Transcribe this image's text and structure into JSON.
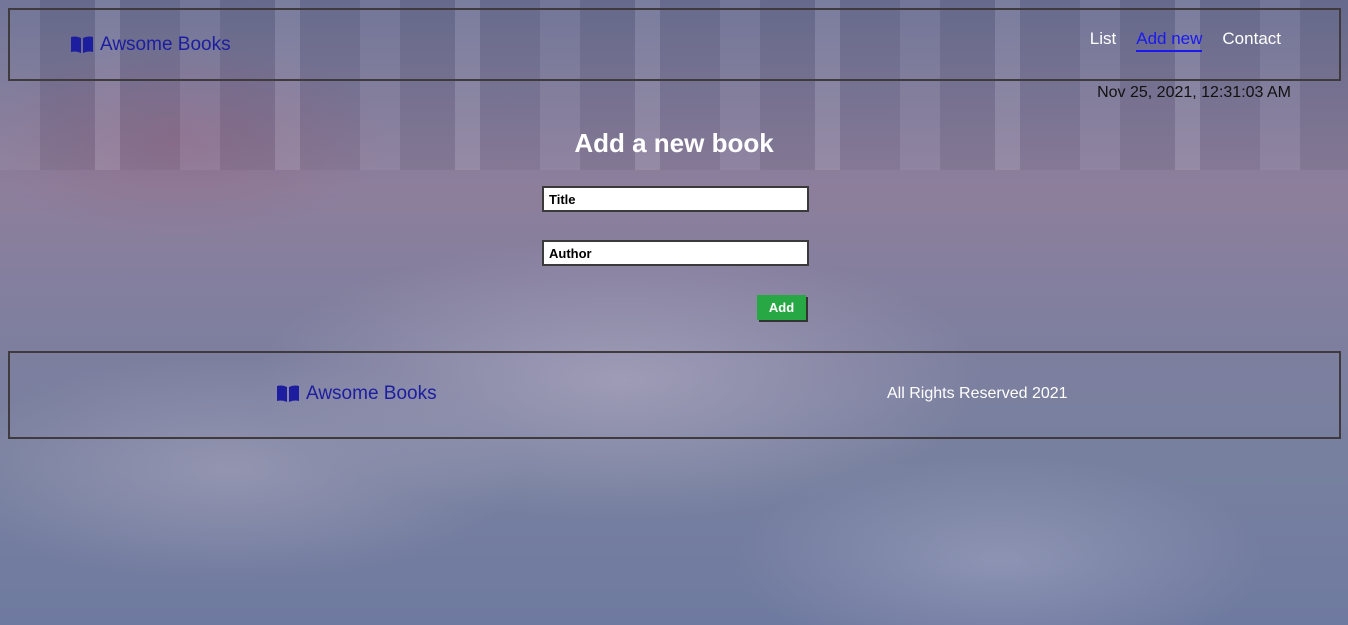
{
  "header": {
    "brand": "Awsome Books",
    "nav": [
      {
        "label": "List"
      },
      {
        "label": "Add new",
        "active": true
      },
      {
        "label": "Contact"
      }
    ]
  },
  "datetime": "Nov 25, 2021, 12:31:03 AM",
  "form": {
    "title": "Add a new book",
    "title_placeholder": "Title",
    "author_placeholder": "Author",
    "title_value": "",
    "author_value": "",
    "add_label": "Add"
  },
  "footer": {
    "brand": "Awsome Books",
    "rights": "All Rights Reserved 2021"
  },
  "colors": {
    "brand": "#1d1da0",
    "active_nav": "#1a1aee",
    "add_button": "#28a745"
  },
  "icons": {
    "brand_icon": "book-open-icon"
  }
}
